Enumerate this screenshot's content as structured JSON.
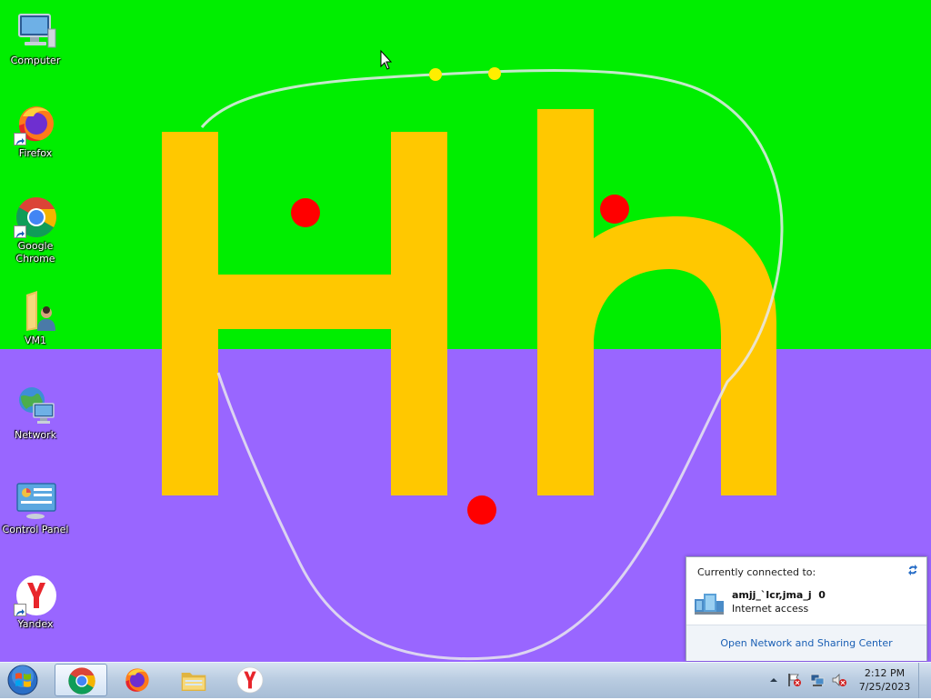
{
  "desktop": {
    "icons": [
      {
        "label": "Computer",
        "icon": "computer-icon"
      },
      {
        "label": "Firefox",
        "icon": "firefox-icon"
      },
      {
        "label": "Google Chrome",
        "icon": "chrome-icon"
      },
      {
        "label": "VM1",
        "icon": "user-folder-icon"
      },
      {
        "label": "Network",
        "icon": "network-icon"
      },
      {
        "label": "Control Panel",
        "icon": "control-panel-icon"
      },
      {
        "label": "Yandex",
        "icon": "yandex-icon"
      }
    ],
    "wallpaper": {
      "top_color": "#00ee00",
      "bottom_color": "#9966ff",
      "letter_color": "#ffc800",
      "dot_color": "#ff0000",
      "small_dot_color": "#ffee00",
      "letters": "Hh"
    }
  },
  "network_popup": {
    "heading": "Currently connected to:",
    "connection_name": "amjj_`lcr,jma_j  0",
    "connection_status": "Internet access",
    "footer_link": "Open Network and Sharing Center"
  },
  "taskbar": {
    "pinned": [
      {
        "name": "Google Chrome",
        "icon": "chrome-icon",
        "active": true
      },
      {
        "name": "Firefox",
        "icon": "firefox-icon",
        "active": false
      },
      {
        "name": "Windows Explorer",
        "icon": "folder-icon",
        "active": false
      },
      {
        "name": "Yandex",
        "icon": "yandex-icon",
        "active": false
      }
    ],
    "tray_icons": [
      "show-hidden-icons-arrow",
      "action-center-flag-icon",
      "network-icon",
      "volume-muted-icon"
    ],
    "clock": {
      "time": "2:12 PM",
      "date": "7/25/2023"
    }
  }
}
